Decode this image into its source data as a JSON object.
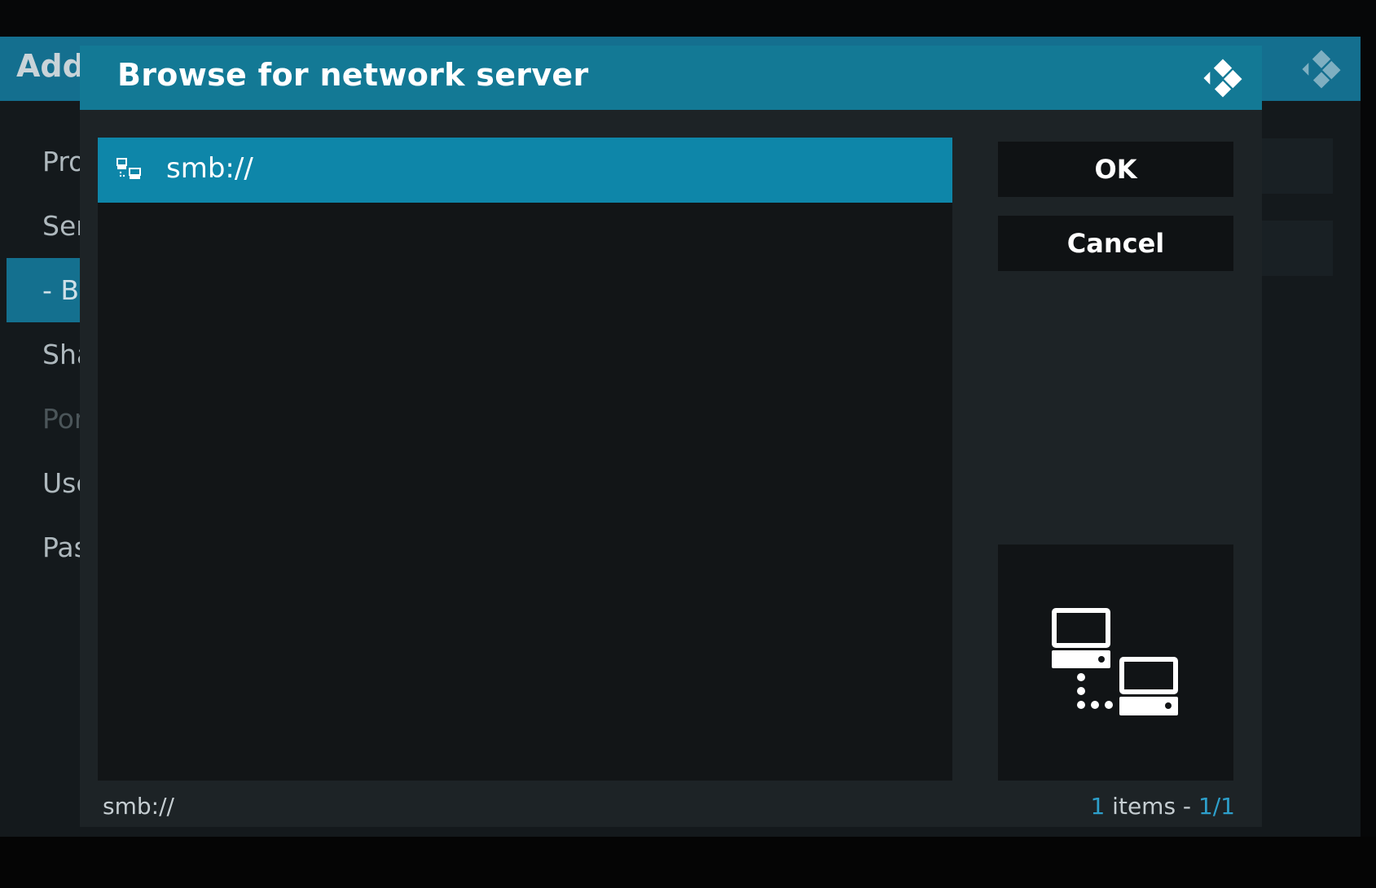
{
  "colors": {
    "header": "#137995",
    "selection": "#0e86a9",
    "accent": "#2d9fca",
    "dialog_bg": "#1d2326",
    "list_bg": "#121517"
  },
  "background_window": {
    "title": "Add",
    "logo_icon": "kodi-logo-icon",
    "menu_items": [
      {
        "label": "Pro"
      },
      {
        "label": "Ser"
      },
      {
        "label": "- Br"
      },
      {
        "label": "Sha"
      },
      {
        "label": "Por"
      },
      {
        "label": "Use"
      },
      {
        "label": "Pas"
      }
    ]
  },
  "dialog": {
    "title": "Browse for network server",
    "logo_icon": "kodi-logo-icon",
    "list": {
      "items": [
        {
          "label": "smb://",
          "icon": "network-icon",
          "selected": true
        }
      ]
    },
    "buttons": {
      "ok_label": "OK",
      "cancel_label": "Cancel"
    },
    "preview_icon": "network-computers-icon",
    "status": {
      "path": "smb://",
      "count": "1",
      "items_text": " items - ",
      "page": "1/1"
    }
  }
}
